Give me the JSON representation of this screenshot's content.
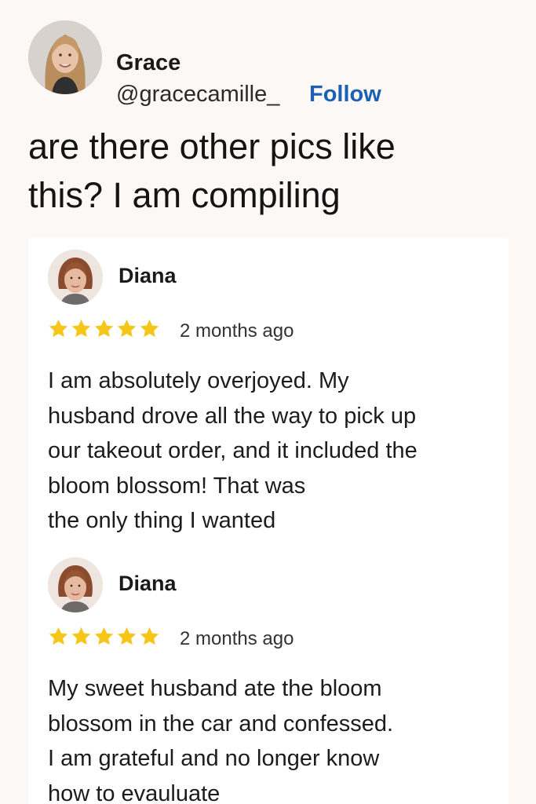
{
  "tweet": {
    "author_name": "Grace",
    "author_handle": "@gracecamille_",
    "follow_label": "Follow",
    "text_lines": [
      "are there other pics like",
      "this? I am compiling"
    ]
  },
  "reviews": [
    {
      "name": "Diana",
      "stars": 5,
      "time": "2 months ago",
      "body_lines": [
        "I am absolutely overjoyed. My",
        "husband drove all the way to pick up",
        "our takeout order, and it included the",
        "bloom blossom! That was",
        "the only thing I wanted"
      ]
    },
    {
      "name": "Diana",
      "stars": 5,
      "time": "2 months ago",
      "body_lines": [
        "My sweet husband ate the bloom",
        "blossom in the car and confessed.",
        "I am grateful and no longer know",
        "how to evauluate"
      ]
    }
  ],
  "colors": {
    "page_background": "#fcf8f5",
    "follow_link": "#1d5fb3",
    "star": "#f5c518"
  }
}
